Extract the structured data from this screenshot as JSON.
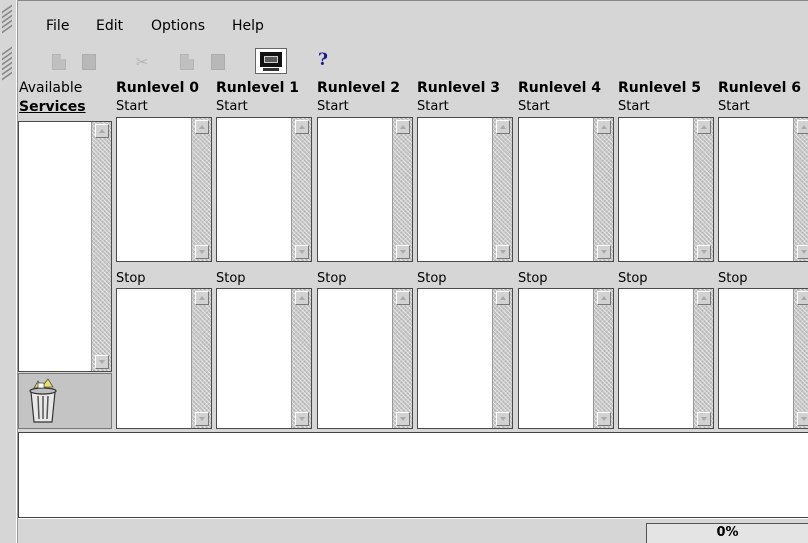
{
  "menu": [
    {
      "label": "File"
    },
    {
      "label": "Edit"
    },
    {
      "label": "Options"
    },
    {
      "label": "Help"
    }
  ],
  "toolbar": {
    "icons": [
      "new-document-icon",
      "save-icon",
      "cut-icon",
      "copy-icon",
      "paste-icon",
      "monitor-icon",
      "help-icon"
    ],
    "help_label": "?"
  },
  "available": {
    "line1": "Available",
    "line2": "Services"
  },
  "runlevels": [
    {
      "title": "Runlevel 0",
      "start": "Start",
      "stop": "Stop"
    },
    {
      "title": "Runlevel 1",
      "start": "Start",
      "stop": "Stop"
    },
    {
      "title": "Runlevel 2",
      "start": "Start",
      "stop": "Stop"
    },
    {
      "title": "Runlevel 3",
      "start": "Start",
      "stop": "Stop"
    },
    {
      "title": "Runlevel 4",
      "start": "Start",
      "stop": "Stop"
    },
    {
      "title": "Runlevel 5",
      "start": "Start",
      "stop": "Stop"
    },
    {
      "title": "Runlevel 6",
      "start": "Start",
      "stop": "Stop"
    }
  ],
  "status": {
    "progress": "0%"
  }
}
